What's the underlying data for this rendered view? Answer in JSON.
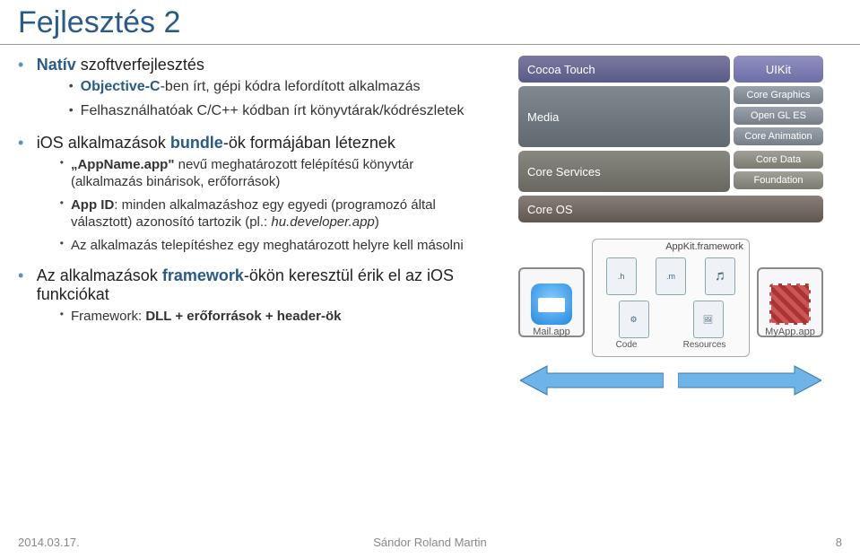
{
  "title": "Fejlesztés 2",
  "bullets": {
    "b1": {
      "label_prefix": "Natív",
      "label_rest": " szoftverfejlesztés",
      "sub": [
        {
          "pre": "Objective-C",
          "rest": "-ben írt, gépi kódra lefordított alkalmazás"
        },
        {
          "pre": "",
          "rest": "Felhasználhatóak C/C++ kódban írt könyvtárak/kódrészletek"
        }
      ]
    },
    "b2": {
      "pre": "iOS alkalmazások ",
      "bold": "bundle",
      "post": "-ök formájában léteznek",
      "sub": [
        {
          "bold": "„AppName.app\"",
          "rest": " nevű meghatározott felépítésű könyvtár (alkalmazás binárisok, erőforrások)"
        },
        {
          "bold": "App ID",
          "rest": ": minden alkalmazáshoz egy egyedi (programozó által választott) azonosító tartozik (pl.: ",
          "ital": "hu.developer.app",
          "tail": ")"
        },
        {
          "rest": "Az alkalmazás telepítéshez egy meghatározott helyre kell másolni"
        }
      ]
    },
    "b3": {
      "pre": "Az alkalmazások ",
      "bold": "framework",
      "post": "-ökön keresztül érik el az iOS funkciókat",
      "sub": [
        {
          "rest": "Framework: ",
          "bold": "DLL + erőforrások + header-ök"
        }
      ]
    }
  },
  "ios_stack": {
    "cocoa": "Cocoa Touch",
    "uikit": "UIKit",
    "media": "Media",
    "media_sub": [
      "Core Graphics",
      "Open GL ES",
      "Core Animation"
    ],
    "core_services": "Core Services",
    "services_sub": [
      "Core Data",
      "Foundation"
    ],
    "core_os": "Core OS"
  },
  "diagram": {
    "mail": "Mail.app",
    "myapp": "MyApp.app",
    "appkit": "AppKit.framework",
    "code_lbl": "Code",
    "res_lbl": "Resources",
    "file_h": ".h",
    "file_m": ".m"
  },
  "footer": {
    "date": "2014.03.17.",
    "author": "Sándor Roland Martin",
    "page": "8"
  }
}
